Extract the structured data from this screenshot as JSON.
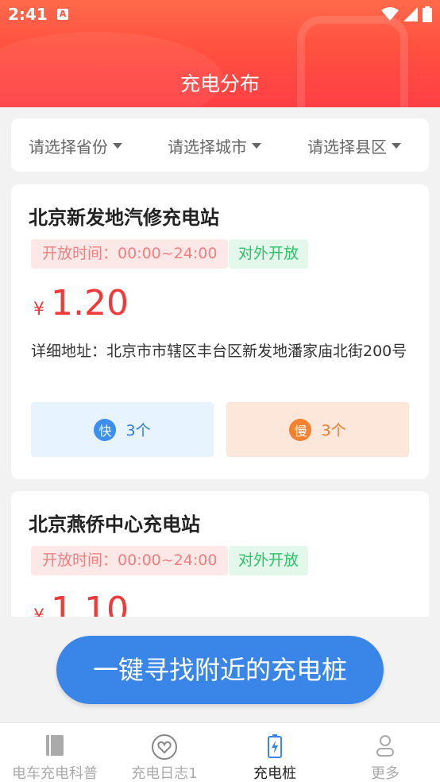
{
  "status_bar": {
    "time": "2:41",
    "notif_letter": "A"
  },
  "header": {
    "title": "充电分布"
  },
  "filters": [
    {
      "label": "请选择省份"
    },
    {
      "label": "请选择城市"
    },
    {
      "label": "请选择县区"
    }
  ],
  "stations": [
    {
      "name": "北京新发地汽修充电站",
      "hours": "开放时间：00:00~24:00",
      "open_tag": "对外开放",
      "currency": "¥",
      "price": "1.20",
      "address": "详细地址：北京市市辖区丰台区新发地潘家庙北街200号",
      "fast_badge": "快",
      "fast_count": "3个",
      "slow_badge": "慢",
      "slow_count": "3个"
    },
    {
      "name": "北京燕侨中心充电站",
      "hours": "开放时间：00:00~24:00",
      "open_tag": "对外开放",
      "currency": "¥",
      "price": "1.10"
    }
  ],
  "cta": {
    "label": "一键寻找附近的充电桩"
  },
  "tabs": [
    {
      "label": "电车充电科普",
      "icon": "book-icon"
    },
    {
      "label": "充电日志1",
      "icon": "heart-icon"
    },
    {
      "label": "充电桩",
      "icon": "battery-charge-icon",
      "active": true
    },
    {
      "label": "更多",
      "icon": "person-icon"
    }
  ],
  "colors": {
    "header_red": "#ff4f42",
    "price_red": "#f03a3a",
    "accent_blue": "#3a86e8",
    "open_green": "#2ec26a",
    "slow_orange": "#f5812e"
  }
}
